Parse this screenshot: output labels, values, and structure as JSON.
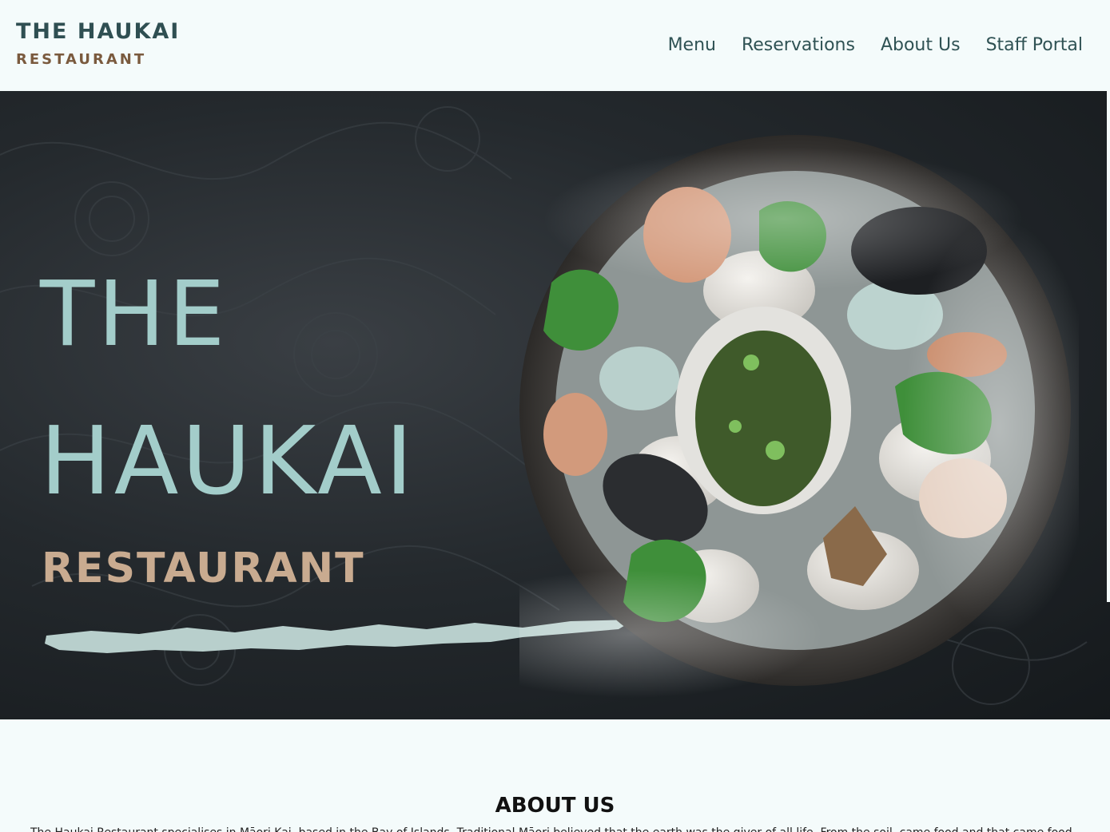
{
  "header": {
    "logo_title": "THE HAUKAI",
    "logo_subtitle": "RESTAURANT",
    "nav": [
      "Menu",
      "Reservations",
      "About Us",
      "Staff Portal"
    ]
  },
  "hero": {
    "line1": "THE",
    "line2": "HAUKAI",
    "line3": "RESTAURANT"
  },
  "about": {
    "heading": "ABOUT US",
    "text": "The Haukai Restaurant specialises in Māori Kai, based in the Bay of Islands. Traditional Māori believed that the earth was the giver of all life. From the soil, came food and that came food"
  },
  "colors": {
    "background": "#f4fbfb",
    "header_text": "#2f4f52",
    "logo_subtitle": "#7a5a3e",
    "hero_title": "#a3cdca",
    "hero_restaurant": "#c9ab90"
  }
}
